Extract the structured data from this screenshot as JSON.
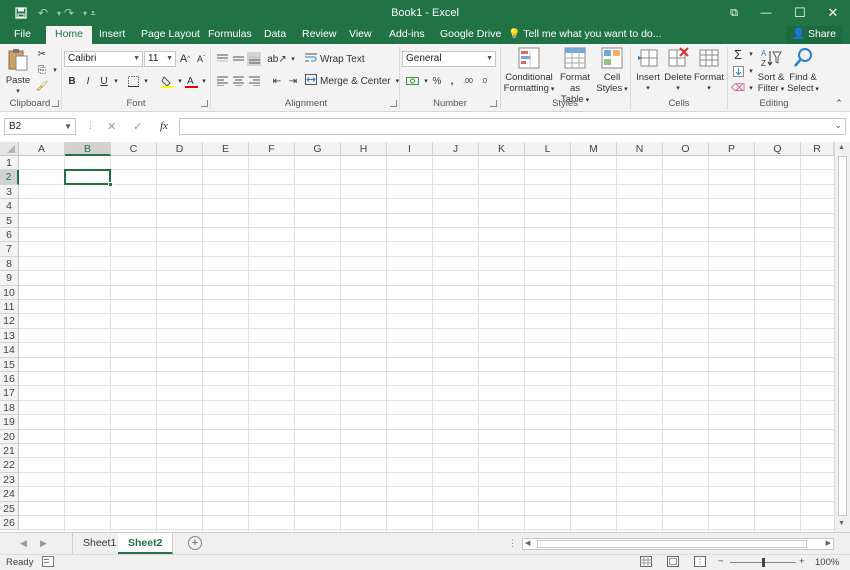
{
  "window": {
    "title": "Book1 - Excel",
    "restore_symbol": "⧉",
    "minimize_symbol": "—",
    "maximize_symbol": "☐",
    "close_symbol": "✕"
  },
  "quick_access": {
    "save_icon": "save-icon",
    "undo_icon": "undo-icon",
    "redo_icon": "redo-icon",
    "customize_icon": "customize-icon"
  },
  "tabs": [
    "File",
    "Home",
    "Insert",
    "Page Layout",
    "Formulas",
    "Data",
    "Review",
    "View",
    "Add-ins",
    "Google Drive"
  ],
  "active_tab": "Home",
  "tell_me": "Tell me what you want to do...",
  "share": "Share",
  "ribbon": {
    "clipboard": {
      "label": "Clipboard",
      "paste": "Paste"
    },
    "font": {
      "label": "Font",
      "family": "Calibri",
      "size": "11",
      "bold": "B",
      "italic": "I",
      "underline": "U"
    },
    "alignment": {
      "label": "Alignment",
      "wrap_text": "Wrap Text",
      "merge_center": "Merge & Center"
    },
    "number": {
      "label": "Number",
      "format": "General",
      "percent": "%",
      "comma": ","
    },
    "styles": {
      "label": "Styles",
      "conditional_l1": "Conditional",
      "conditional_l2": "Formatting",
      "format_table_l1": "Format as",
      "format_table_l2": "Table",
      "cell_styles_l1": "Cell",
      "cell_styles_l2": "Styles"
    },
    "cells": {
      "label": "Cells",
      "insert": "Insert",
      "delete": "Delete",
      "format": "Format"
    },
    "editing": {
      "label": "Editing",
      "sort_l1": "Sort &",
      "sort_l2": "Filter",
      "find_l1": "Find &",
      "find_l2": "Select"
    }
  },
  "formula_bar": {
    "name_box": "B2",
    "cancel": "✕",
    "enter": "✓",
    "fx": "fx",
    "value": ""
  },
  "grid": {
    "columns": [
      "A",
      "B",
      "C",
      "D",
      "E",
      "F",
      "G",
      "H",
      "I",
      "J",
      "K",
      "L",
      "M",
      "N",
      "O",
      "P",
      "Q",
      "R"
    ],
    "rows": [
      "1",
      "2",
      "3",
      "4",
      "5",
      "6",
      "7",
      "8",
      "9",
      "10",
      "11",
      "12",
      "13",
      "14",
      "15",
      "16",
      "17",
      "18",
      "19",
      "20",
      "21",
      "22",
      "23",
      "24",
      "25",
      "26"
    ],
    "selected_column": "B",
    "selected_row": "2"
  },
  "sheets": [
    "Sheet1",
    "Sheet2"
  ],
  "active_sheet": "Sheet2",
  "add_sheet": "+",
  "status": {
    "ready": "Ready",
    "zoom": "100%",
    "zoom_minus": "−",
    "zoom_plus": "+"
  },
  "colors": {
    "accent": "#217346"
  }
}
